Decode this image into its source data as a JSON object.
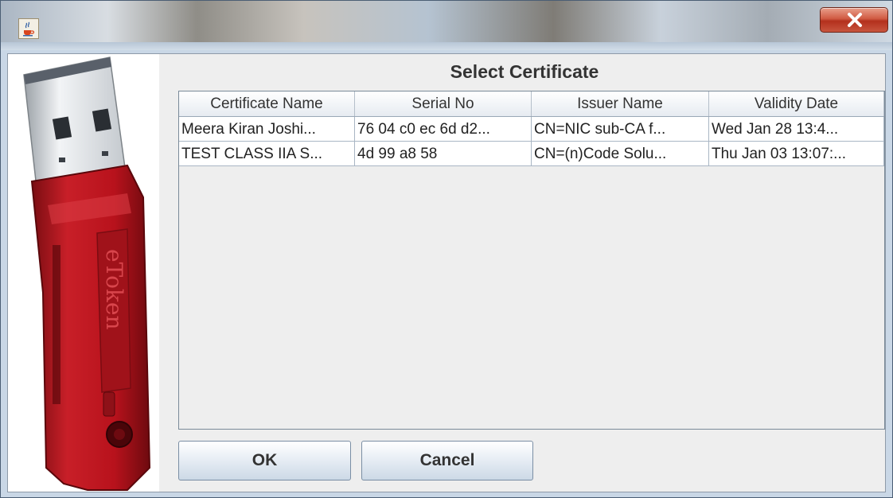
{
  "window": {
    "title": "",
    "app_icon": "java-cup-icon",
    "close_icon": "close-x-icon",
    "close_color": "#c8412b"
  },
  "dialog": {
    "title": "Select Certificate",
    "art": {
      "icon": "usb-token-icon",
      "brand": "eToken",
      "body_color": "#c0202a"
    }
  },
  "table": {
    "columns": [
      "Certificate Name",
      "Serial No",
      "Issuer Name",
      "Validity Date"
    ],
    "rows": [
      [
        "Meera Kiran Joshi...",
        "76 04 c0 ec 6d d2...",
        "CN=NIC sub-CA f...",
        "Wed Jan 28 13:4..."
      ],
      [
        "TEST CLASS IIA S...",
        "4d 99 a8 58",
        "CN=(n)Code Solu...",
        "Thu Jan 03 13:07:..."
      ]
    ]
  },
  "buttons": {
    "ok": "OK",
    "cancel": "Cancel"
  }
}
